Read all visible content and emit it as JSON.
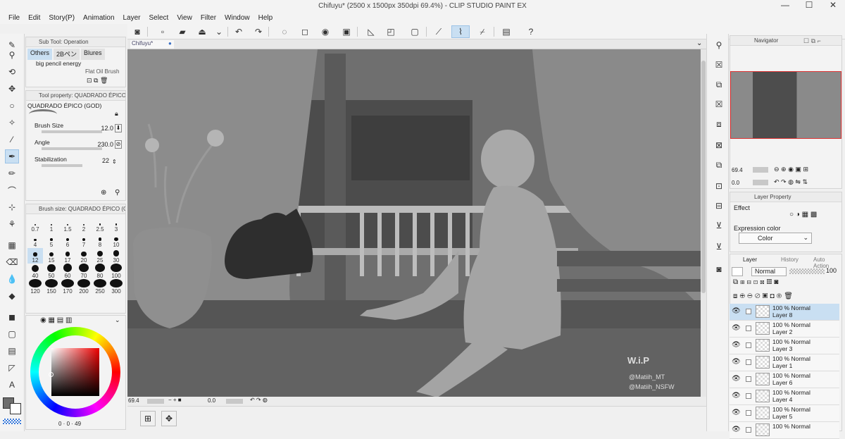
{
  "window": {
    "title": "Chifuyu* (2500 x 1500px 350dpi 69.4%) - CLIP STUDIO PAINT EX",
    "minimize": "—",
    "maximize": "☐",
    "close": "✕"
  },
  "menu": [
    "File",
    "Edit",
    "Story(P)",
    "Animation",
    "Layer",
    "Select",
    "View",
    "Filter",
    "Window",
    "Help"
  ],
  "sub_tool": {
    "header": "Sub Tool: Operation",
    "tabs": [
      "Others",
      "2Bペン",
      "Blures"
    ],
    "items": [
      "big pencil energy",
      "Flat Oil Brush"
    ]
  },
  "tool_property": {
    "header": "Tool property: QUADRADO ÉPICO (GOD)",
    "brush_name": "QUADRADO ÉPICO (GOD)",
    "brush_size_label": "Brush Size",
    "brush_size_value": "12.0",
    "angle_label": "Angle",
    "angle_value": "230.0",
    "stabilization_label": "Stabilization",
    "stabilization_value": "22"
  },
  "brush_size_panel": {
    "header": "Brush size: QUADRADO ÉPICO (GO",
    "sizes": [
      [
        "0.7",
        "1",
        "1.5",
        "2",
        "2.5",
        "3"
      ],
      [
        "4",
        "5",
        "6",
        "7",
        "8",
        "10"
      ],
      [
        "12",
        "15",
        "17",
        "20",
        "25",
        "30"
      ],
      [
        "40",
        "50",
        "60",
        "70",
        "80",
        "100"
      ],
      [
        "120",
        "150",
        "170",
        "200",
        "250",
        "300"
      ]
    ],
    "selected": "12"
  },
  "color": {
    "main": "#6d6d6d",
    "sub": "#ffffff",
    "hsv_readout": [
      "0",
      "0",
      "49"
    ]
  },
  "document": {
    "tab": "Chifuyu*",
    "watermark": [
      "W.i.P",
      "@Matiih_MT",
      "@Matiih_NSFW"
    ]
  },
  "status": {
    "zoom": "69.4",
    "rotate": "0.0"
  },
  "navigator": {
    "header": "Navigator",
    "zoom": "69.4",
    "rotate": "0.0"
  },
  "layer_property": {
    "header": "Layer Property",
    "effect_label": "Effect",
    "expression_label": "Expression color",
    "expression_value": "Color"
  },
  "layer_panel": {
    "tabs": [
      "Layer",
      "History",
      "Auto Action"
    ],
    "blend_mode": "Normal",
    "opacity": "100",
    "layers": [
      {
        "mode": "100 % Normal",
        "name": "Layer 8",
        "selected": true
      },
      {
        "mode": "100 % Normal",
        "name": "Layer 2",
        "selected": false
      },
      {
        "mode": "100 % Normal",
        "name": "Layer 3",
        "selected": false
      },
      {
        "mode": "100 % Normal",
        "name": "Layer 1",
        "selected": false
      },
      {
        "mode": "100 % Normal",
        "name": "Layer 6",
        "selected": false
      },
      {
        "mode": "100 % Normal",
        "name": "Layer 4",
        "selected": false
      },
      {
        "mode": "100 % Normal",
        "name": "Layer 5",
        "selected": false
      },
      {
        "mode": "100 % Normal",
        "name": "",
        "selected": false
      }
    ]
  },
  "accent": "#c9dff2"
}
